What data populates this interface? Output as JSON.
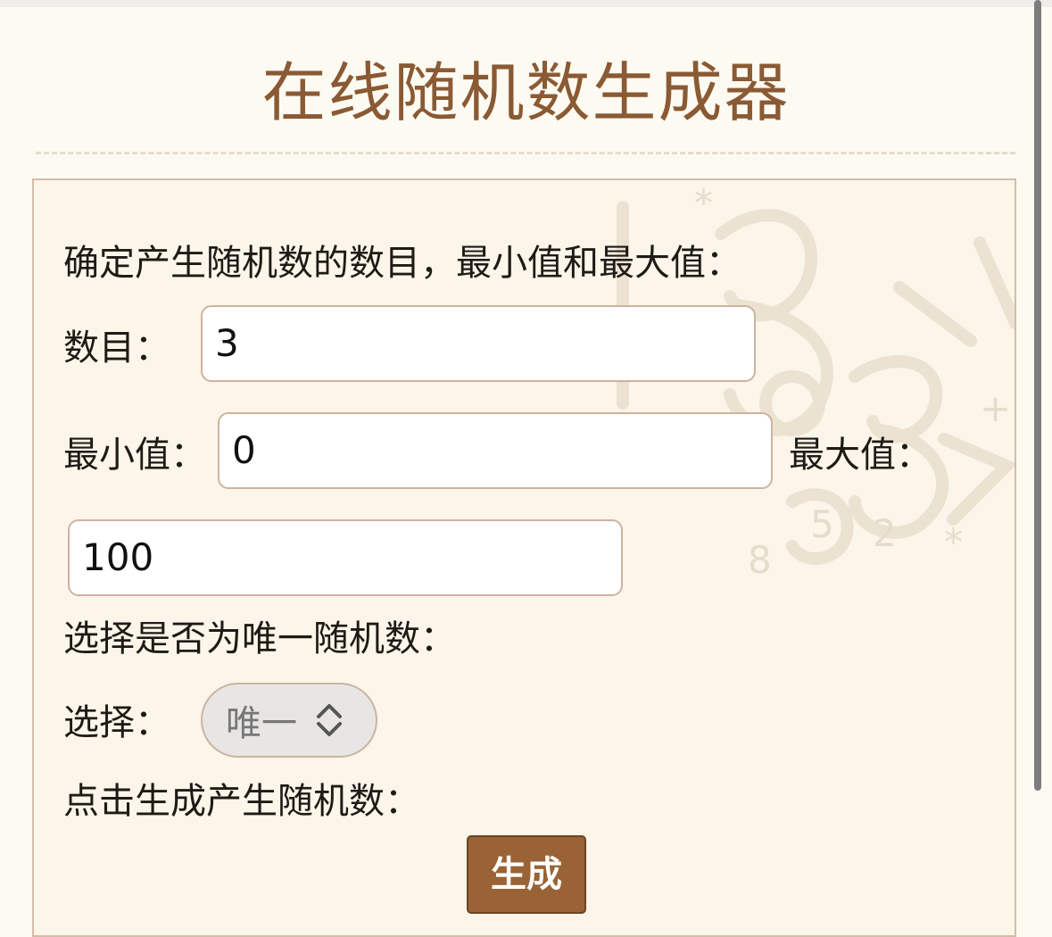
{
  "page": {
    "title": "在线随机数生成器"
  },
  "form": {
    "intro": "确定产生随机数的数目，最小值和最大值：",
    "count_label": "数目：",
    "count_value": "3",
    "min_label": "最小值：",
    "min_value": "0",
    "max_label": "最大值：",
    "max_value": "100",
    "unique_intro": "选择是否为唯一随机数：",
    "select_label": "选择：",
    "select_value": "唯一",
    "generate_intro": "点击生成产生随机数：",
    "generate_button": "生成"
  },
  "colors": {
    "title": "#8a5a34",
    "button": "#9a6335",
    "panel": "#fbf5ea",
    "border": "#cdb3a1"
  },
  "icons": {
    "select_chevron": "chevron-updown-icon"
  }
}
